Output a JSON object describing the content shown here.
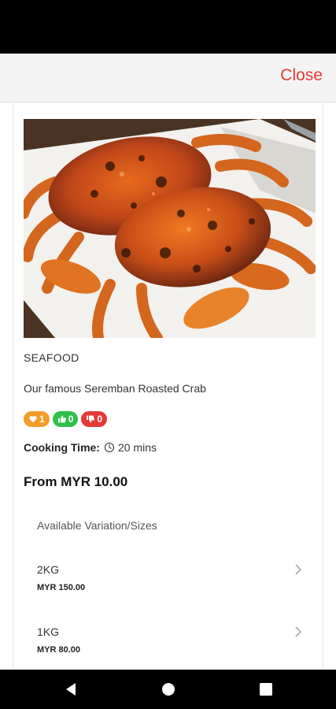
{
  "header": {
    "close_label": "Close"
  },
  "product": {
    "image_icon": "roasted-crab-photo",
    "category": "SEAFOOD",
    "description": "Our famous Seremban Roasted Crab",
    "reactions": {
      "love_count": "1",
      "like_count": "0",
      "dislike_count": "0"
    },
    "cooking_time_label": "Cooking Time:",
    "cooking_time_value": "20 mins",
    "price_from": "From MYR 10.00"
  },
  "variations": {
    "title": "Available Variation/Sizes",
    "items": [
      {
        "name": "2KG",
        "price": "MYR 150.00"
      },
      {
        "name": "1KG",
        "price": "MYR 80.00"
      }
    ]
  },
  "colors": {
    "accent": "#e53935",
    "love": "#f39c2b",
    "like": "#2fbf4a",
    "dislike": "#e53935"
  }
}
